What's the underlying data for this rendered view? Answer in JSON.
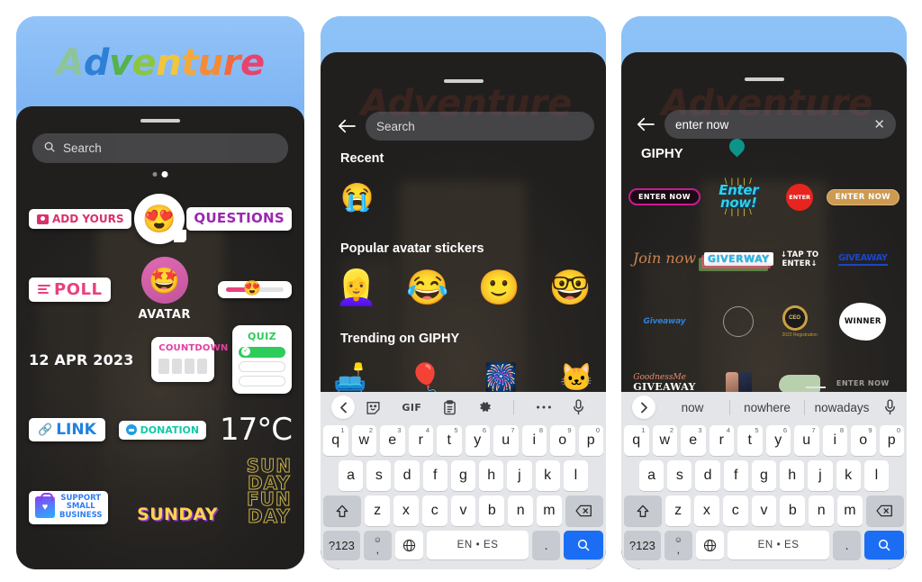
{
  "phone1": {
    "story_title": {
      "text": "Adventure",
      "letters": [
        {
          "ch": "A",
          "color": "#8dc49a"
        },
        {
          "ch": "d",
          "color": "#2f7fd6"
        },
        {
          "ch": "v",
          "color": "#56b24a"
        },
        {
          "ch": "e",
          "color": "#8cc63f"
        },
        {
          "ch": "n",
          "color": "#f2c53d"
        },
        {
          "ch": "t",
          "color": "#f5a83c"
        },
        {
          "ch": "u",
          "color": "#f58b36"
        },
        {
          "ch": "r",
          "color": "#f26a3d"
        },
        {
          "ch": "e",
          "color": "#e8436b"
        }
      ]
    },
    "search": {
      "placeholder": "Search",
      "icon": "search-icon"
    },
    "page_dots": {
      "count": 2,
      "active_index": 1
    },
    "stickers": {
      "add_yours": "ADD YOURS",
      "questions": "QUESTIONS",
      "emoji_reaction": "😍",
      "poll": "POLL",
      "avatar_label": "AVATAR",
      "avatar_emoji": "🤩",
      "emoji_slider_emoji": "😍",
      "date": "12 APR 2023",
      "countdown": "COUNTDOWN",
      "quiz": "QUIZ",
      "link": "LINK",
      "donation": "DONATION",
      "temperature": "17°C",
      "support_small_business": [
        "SUPPORT",
        "SMALL",
        "BUSINESS"
      ],
      "sunday": "SUNDAY",
      "sunday_fun_day": [
        "SUN",
        "DAY",
        "FUN",
        "DAY"
      ]
    }
  },
  "phone2": {
    "back_icon": "back-arrow-icon",
    "search": {
      "placeholder": "Search",
      "value": ""
    },
    "ghost_title": "Adventure",
    "sections": [
      {
        "title": "Recent",
        "items": [
          "😭"
        ]
      },
      {
        "title": "Popular avatar stickers",
        "items": [
          "👱‍♀️",
          "😂",
          "🙂",
          "🤓"
        ]
      },
      {
        "title": "Trending on GIPHY",
        "items": [
          "🛋️",
          "🎈",
          "🎆",
          "🐱"
        ]
      }
    ],
    "keyboard": {
      "tools": [
        "sticker-icon",
        "GIF",
        "clipboard-icon",
        "gear-icon",
        "more-icon",
        "mic-icon"
      ],
      "collapse_icon": "chevron-left-icon",
      "row1": [
        {
          "k": "q",
          "n": "1"
        },
        {
          "k": "w",
          "n": "2"
        },
        {
          "k": "e",
          "n": "3"
        },
        {
          "k": "r",
          "n": "4"
        },
        {
          "k": "t",
          "n": "5"
        },
        {
          "k": "y",
          "n": "6"
        },
        {
          "k": "u",
          "n": "7"
        },
        {
          "k": "i",
          "n": "8"
        },
        {
          "k": "o",
          "n": "9"
        },
        {
          "k": "p",
          "n": "0"
        }
      ],
      "row2": [
        "a",
        "s",
        "d",
        "f",
        "g",
        "h",
        "j",
        "k",
        "l"
      ],
      "row3": [
        "z",
        "x",
        "c",
        "v",
        "b",
        "n",
        "m"
      ],
      "shift_icon": "shift-icon",
      "backspace_icon": "backspace-icon",
      "symbols_key": "?123",
      "emoji_key": "emoji-comma-key",
      "globe_key": "globe-icon",
      "space_label": "EN • ES",
      "period_key": ".",
      "enter_icon": "search-icon"
    }
  },
  "phone3": {
    "back_icon": "back-arrow-icon",
    "search": {
      "value": "enter now",
      "clear_icon": "close-icon"
    },
    "cursor_handle_color": "#0d9488",
    "results_title": "GIPHY",
    "results": [
      {
        "name": "enter-now-magenta-pill",
        "label": "ENTER NOW",
        "style": "pill-magenta"
      },
      {
        "name": "enter-now-burst",
        "label": "Enter now!",
        "style": "burst"
      },
      {
        "name": "enter-red-circle",
        "label": "ENTER",
        "style": "red-circle"
      },
      {
        "name": "enter-now-gold-pill",
        "label": "ENTER NOW",
        "style": "pill-gold"
      },
      {
        "name": "join-now-script",
        "label": "Join now",
        "style": "script"
      },
      {
        "name": "giverway-layered",
        "label": "GIVERWAY",
        "style": "layered"
      },
      {
        "name": "tap-to-enter",
        "label": "↓TAP TO ENTER↓",
        "style": "plain"
      },
      {
        "name": "blue-scribble-word",
        "label": "GIVEAWAY",
        "style": "scribble"
      },
      {
        "name": "giveaway-blue-small",
        "label": "Giveaway",
        "style": "small-blue"
      },
      {
        "name": "empty-ring",
        "label": "",
        "style": "ring"
      },
      {
        "name": "gold-seal-badge",
        "label": "CEO",
        "sub": "2022 Registration",
        "style": "seal"
      },
      {
        "name": "winner-white-blob",
        "label": "WINNER",
        "style": "blob"
      },
      {
        "name": "goodnessme-giveaway",
        "label": "GoodnessMe",
        "sub": "GIVEAWAY",
        "style": "goodness"
      },
      {
        "name": "two-phones-art",
        "label": "",
        "style": "phones"
      },
      {
        "name": "green-shoe",
        "label": "",
        "style": "shoe"
      },
      {
        "name": "enter-now-faint",
        "label": "ENTER NOW",
        "style": "faint"
      }
    ],
    "keyboard": {
      "expand_icon": "chevron-right-icon",
      "suggestions": [
        "now",
        "nowhere",
        "nowadays"
      ],
      "mic_icon": "mic-icon",
      "row1": [
        {
          "k": "q",
          "n": "1"
        },
        {
          "k": "w",
          "n": "2"
        },
        {
          "k": "e",
          "n": "3"
        },
        {
          "k": "r",
          "n": "4"
        },
        {
          "k": "t",
          "n": "5"
        },
        {
          "k": "y",
          "n": "6"
        },
        {
          "k": "u",
          "n": "7"
        },
        {
          "k": "i",
          "n": "8"
        },
        {
          "k": "o",
          "n": "9"
        },
        {
          "k": "p",
          "n": "0"
        }
      ],
      "row2": [
        "a",
        "s",
        "d",
        "f",
        "g",
        "h",
        "j",
        "k",
        "l"
      ],
      "row3": [
        "z",
        "x",
        "c",
        "v",
        "b",
        "n",
        "m"
      ],
      "shift_icon": "shift-icon",
      "backspace_icon": "backspace-icon",
      "symbols_key": "?123",
      "globe_key": "globe-icon",
      "space_label": "EN • ES",
      "period_key": ".",
      "enter_icon": "search-icon"
    }
  }
}
